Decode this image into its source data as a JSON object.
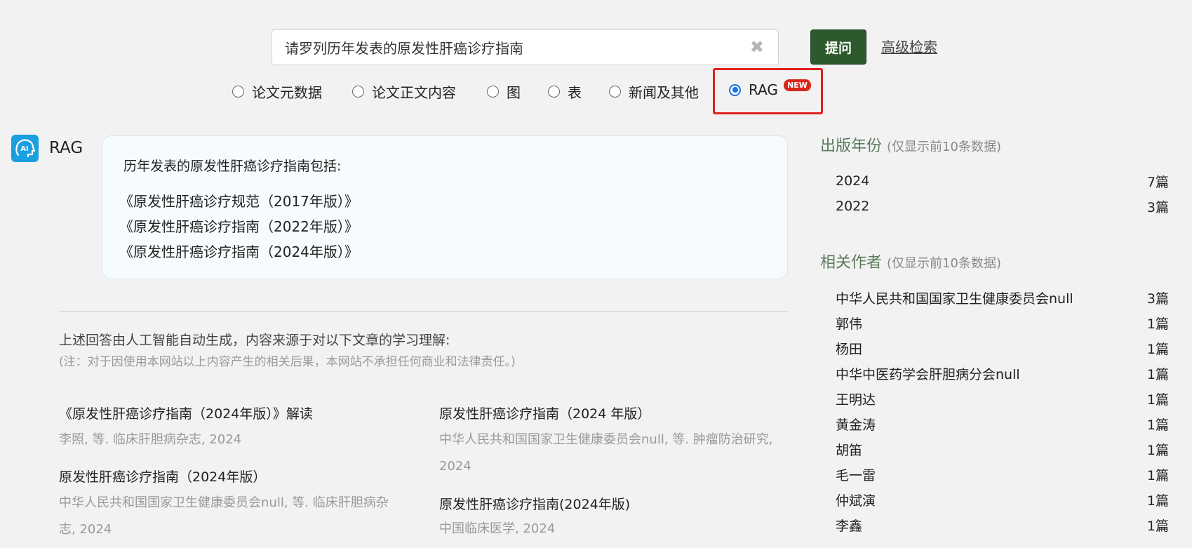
{
  "search": {
    "query": "请罗列历年发表的原发性肝癌诊疗指南",
    "clear_icon": "close-icon",
    "ask_label": "提问",
    "advanced_label": "高级检索"
  },
  "search_modes": {
    "options": [
      "论文元数据",
      "论文正文内容",
      "图",
      "表",
      "新闻及其他",
      "RAG"
    ],
    "selected": "RAG",
    "new_badge": "NEW"
  },
  "rag": {
    "label": "RAG",
    "logo_text": "AI",
    "answer_intro": "历年发表的原发性肝癌诊疗指南包括:",
    "answer_items": [
      "《原发性肝癌诊疗规范（2017年版）》",
      "《原发性肝癌诊疗指南（2022年版）》",
      "《原发性肝癌诊疗指南（2024年版）》"
    ],
    "disclaimer": "上述回答由人工智能自动生成，内容来源于对以下文章的学习理解:",
    "disclaimer_note": "(注：对于因使用本网站以上内容产生的相关后果，本网站不承担任何商业和法律责任。)"
  },
  "references": [
    {
      "title": "《原发性肝癌诊疗指南（2024年版）》解读",
      "meta": "李照, 等. 临床肝胆病杂志, 2024"
    },
    {
      "title": "原发性肝癌诊疗指南（2024 年版）",
      "meta": "中华人民共和国国家卫生健康委员会null, 等. 肿瘤防治研究, 2024"
    },
    {
      "title": "原发性肝癌诊疗指南（2024年版）",
      "meta": "中华人民共和国国家卫生健康委员会null, 等. 临床肝胆病杂志, 2024"
    },
    {
      "title": "原发性肝癌诊疗指南(2024年版)",
      "meta": "中国临床医学, 2024"
    }
  ],
  "sidebar": {
    "year_heading": "出版年份",
    "year_sub": "(仅显示前10条数据)",
    "years": [
      {
        "label": "2024",
        "count": "7篇"
      },
      {
        "label": "2022",
        "count": "3篇"
      }
    ],
    "author_heading": "相关作者",
    "author_sub": "(仅显示前10条数据)",
    "authors": [
      {
        "label": "中华人民共和国国家卫生健康委员会null",
        "count": "3篇"
      },
      {
        "label": "郭伟",
        "count": "1篇"
      },
      {
        "label": "杨田",
        "count": "1篇"
      },
      {
        "label": "中华中医药学会肝胆病分会null",
        "count": "1篇"
      },
      {
        "label": "王明达",
        "count": "1篇"
      },
      {
        "label": "黄金涛",
        "count": "1篇"
      },
      {
        "label": "胡笛",
        "count": "1篇"
      },
      {
        "label": "毛一雷",
        "count": "1篇"
      },
      {
        "label": "仲斌演",
        "count": "1篇"
      },
      {
        "label": "李鑫",
        "count": "1篇"
      }
    ]
  },
  "colors": {
    "accent_green": "#2d5a2c",
    "radio_blue": "#1a73e8",
    "highlight_red": "#e02020",
    "ai_logo_blue": "#1a9fe0"
  }
}
